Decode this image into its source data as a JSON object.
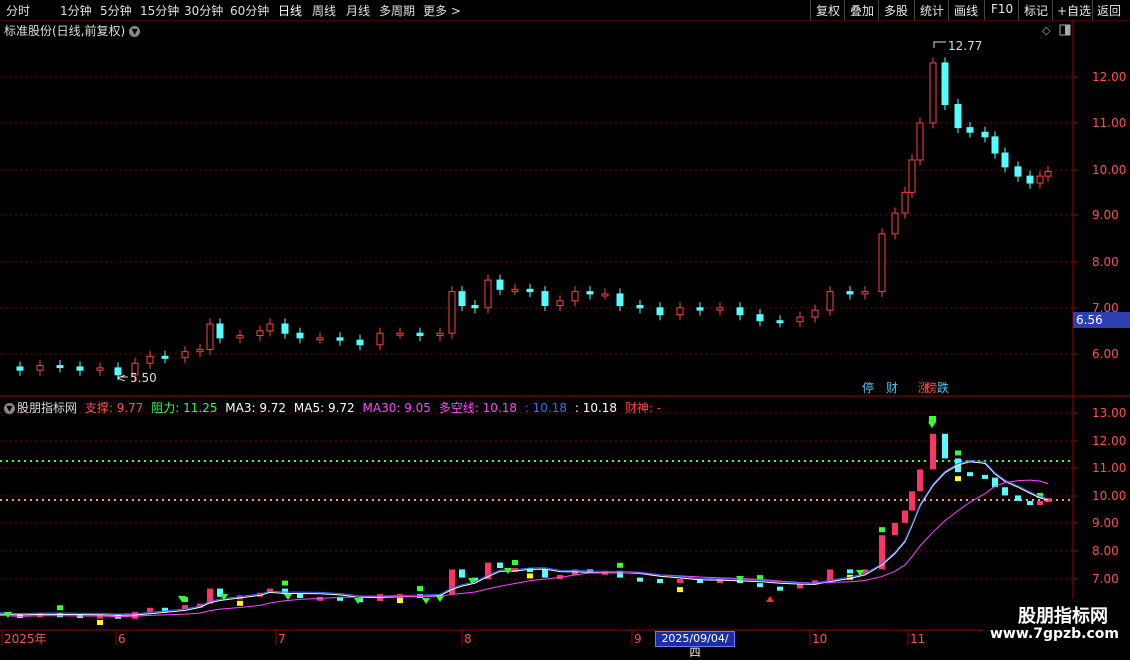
{
  "periods": [
    "分时",
    "1分钟",
    "5分钟",
    "15分钟",
    "30分钟",
    "60分钟",
    "日线",
    "周线",
    "月线",
    "多周期",
    "更多 >"
  ],
  "active_period": "日线",
  "toolbar": [
    "复权",
    "叠加",
    "多股",
    "统计",
    "画线",
    "F10",
    "标记",
    "+自选",
    "返回"
  ],
  "stock_title": "标准股份(日线,前复权)",
  "main_axis": [
    "12.00",
    "11.00",
    "10.00",
    "9.00",
    "8.00",
    "7.00",
    "6.00"
  ],
  "current_price_tag": "6.56",
  "high_label": "12.77",
  "low_label": "5.50",
  "event_markers": [
    {
      "text": "停",
      "color": "#44c8ff"
    },
    {
      "text": "财",
      "color": "#44c8ff"
    },
    {
      "text": "涨",
      "color": "#ff4040"
    },
    {
      "text": "榜",
      "color": "#ff4040"
    },
    {
      "text": "跌",
      "color": "#44c8ff"
    }
  ],
  "indicator": {
    "name": "股朋指标网",
    "items": [
      {
        "label": "支撑: 9.77",
        "color": "#ff5050"
      },
      {
        "label": "阻力: 11.25",
        "color": "#33ff33"
      },
      {
        "label": "MA3: 9.72",
        "color": "#ffffff"
      },
      {
        "label": "MA5: 9.72",
        "color": "#ffffff"
      },
      {
        "label": "MA30: 9.05",
        "color": "#ff44ff"
      },
      {
        "label": "多空线: 10.18",
        "color": "#ff44ff"
      },
      {
        "label": ": 10.18",
        "color": "#3a6bff"
      },
      {
        "label": ": 10.18",
        "color": "#ffffff"
      },
      {
        "label": "财神: -",
        "color": "#ff4040"
      }
    ]
  },
  "sub_axis": [
    "13.00",
    "12.00",
    "11.00",
    "10.00",
    "9.00",
    "8.00",
    "7.00"
  ],
  "date_labels": [
    "2025年",
    "6",
    "7",
    "8",
    "9",
    "10",
    "11"
  ],
  "cursor_date": "2025/09/04/四",
  "watermark_title": "股朋指标网",
  "watermark_url": "www.7gpzb.com",
  "colors": {
    "up": "#ff4040",
    "down": "#54ffff",
    "grid": "#7a0000",
    "axis_text": "#ff5050"
  }
}
